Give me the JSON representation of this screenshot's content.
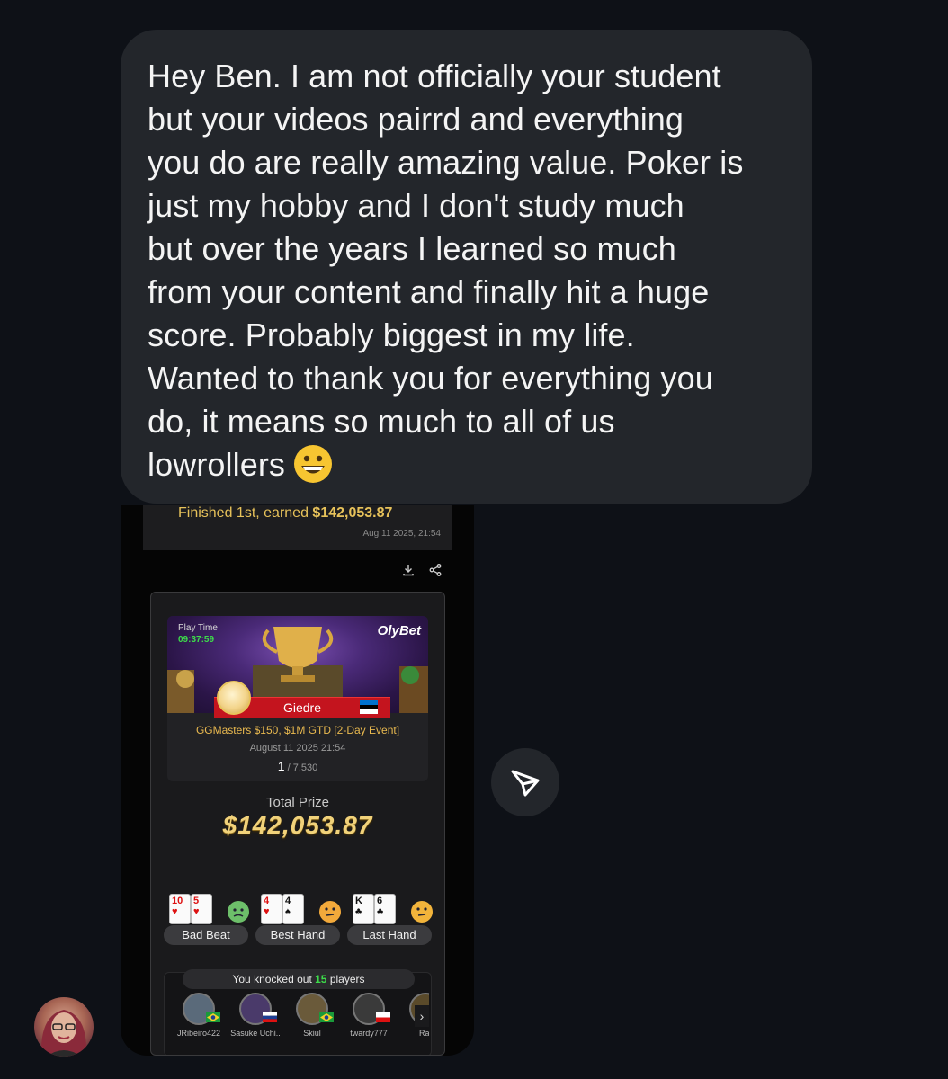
{
  "message": {
    "lines": [
      "Hey Ben. I am not officially your student",
      "but your videos pairrd and everything",
      "you do are really amazing value. Poker is",
      "just my hobby and I don't study much",
      "but over the years I learned so much",
      "from your content and finally hit a huge",
      "score. Probably biggest in my life.",
      "Wanted to thank you for everything you",
      "do, it means so much to all of us",
      "lowrollers"
    ],
    "emoji": "grinning-face-emoji"
  },
  "screenshot": {
    "finished_prefix": "Finished 1st, earned ",
    "finished_amount": "$142,053.87",
    "finished_date": "Aug 11 2025, 21:54",
    "play_time_label": "Play Time",
    "play_time_value": "09:37:59",
    "brand": "OlyBet",
    "player_name": "Giedre",
    "event_name": "GGMasters $150, $1M GTD [2-Day Event]",
    "event_date": "August 11 2025 21:54",
    "place": "1",
    "place_total": " / 7,530",
    "total_prize_label": "Total Prize",
    "total_prize_value": "$142,053.87",
    "hands": [
      {
        "label": "Bad Beat",
        "cards": [
          {
            "rank": "10",
            "suit": "♥",
            "color": "red"
          },
          {
            "rank": "5",
            "suit": "♥",
            "color": "red"
          }
        ]
      },
      {
        "label": "Best Hand",
        "cards": [
          {
            "rank": "4",
            "suit": "♥",
            "color": "red"
          },
          {
            "rank": "4",
            "suit": "♠",
            "color": "black"
          }
        ]
      },
      {
        "label": "Last Hand",
        "cards": [
          {
            "rank": "K",
            "suit": "♣",
            "color": "black"
          },
          {
            "rank": "6",
            "suit": "♣",
            "color": "black"
          }
        ]
      }
    ],
    "knockout_prefix": "You knocked out ",
    "knockout_count": "15",
    "knockout_suffix": " players",
    "knocked_players": [
      "JRibeiro422",
      "Sasuke Uchi..",
      "Skiul",
      "twardy777",
      "Rat"
    ]
  },
  "colors": {
    "background": "#0e1117",
    "bubble": "#23262b",
    "gold": "#e7c25a",
    "green": "#3ddc4a"
  },
  "icons": [
    "download-icon",
    "share-icon",
    "send-icon",
    "chevron-right-icon"
  ]
}
